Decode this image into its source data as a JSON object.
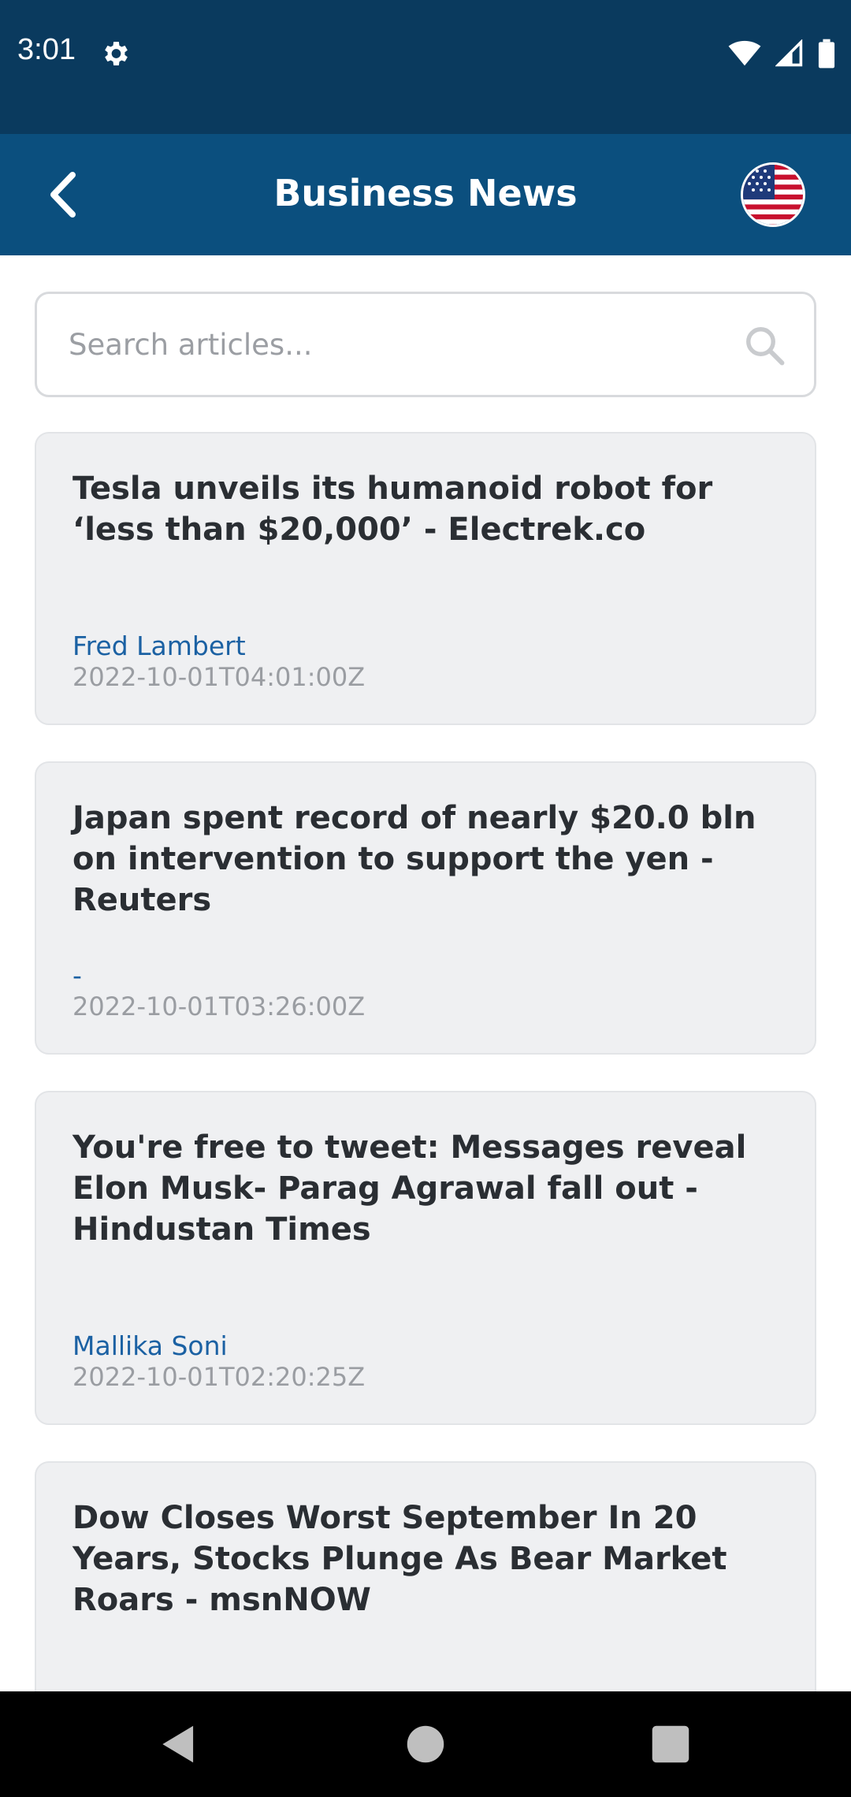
{
  "status_bar": {
    "time": "3:01",
    "icons": [
      "gear-icon",
      "wifi-icon",
      "signal-icon",
      "battery-icon"
    ]
  },
  "app_bar": {
    "title": "Business News",
    "back_icon": "chevron-left-icon",
    "country_flag": "us-flag-icon"
  },
  "search": {
    "placeholder": "Search articles...",
    "value": ""
  },
  "articles": [
    {
      "title": "Tesla unveils its humanoid robot for ‘less than $20,000’ - Electrek.co",
      "author": "Fred Lambert",
      "published": "2022-10-01T04:01:00Z"
    },
    {
      "title": "Japan spent record of nearly $20.0 bln on intervention to support the yen - Reuters",
      "author": "-",
      "published": "2022-10-01T03:26:00Z"
    },
    {
      "title": "You're free to tweet: Messages reveal Elon Musk- Parag Agrawal fall out - Hindustan Times",
      "author": "Mallika Soni",
      "published": "2022-10-01T02:20:25Z"
    },
    {
      "title": "Dow Closes Worst September In 20 Years, Stocks Plunge As Bear Market Roars - msnNOW",
      "author": "",
      "published": ""
    }
  ],
  "colors": {
    "status_bar_bg": "#0a3a5e",
    "app_bar_bg": "#0b4f7e",
    "card_bg": "#eff0f2",
    "author_color": "#1b61a3",
    "date_color": "#9a9da2"
  },
  "nav": {
    "buttons": [
      "back-triangle-icon",
      "home-circle-icon",
      "recents-square-icon"
    ]
  }
}
